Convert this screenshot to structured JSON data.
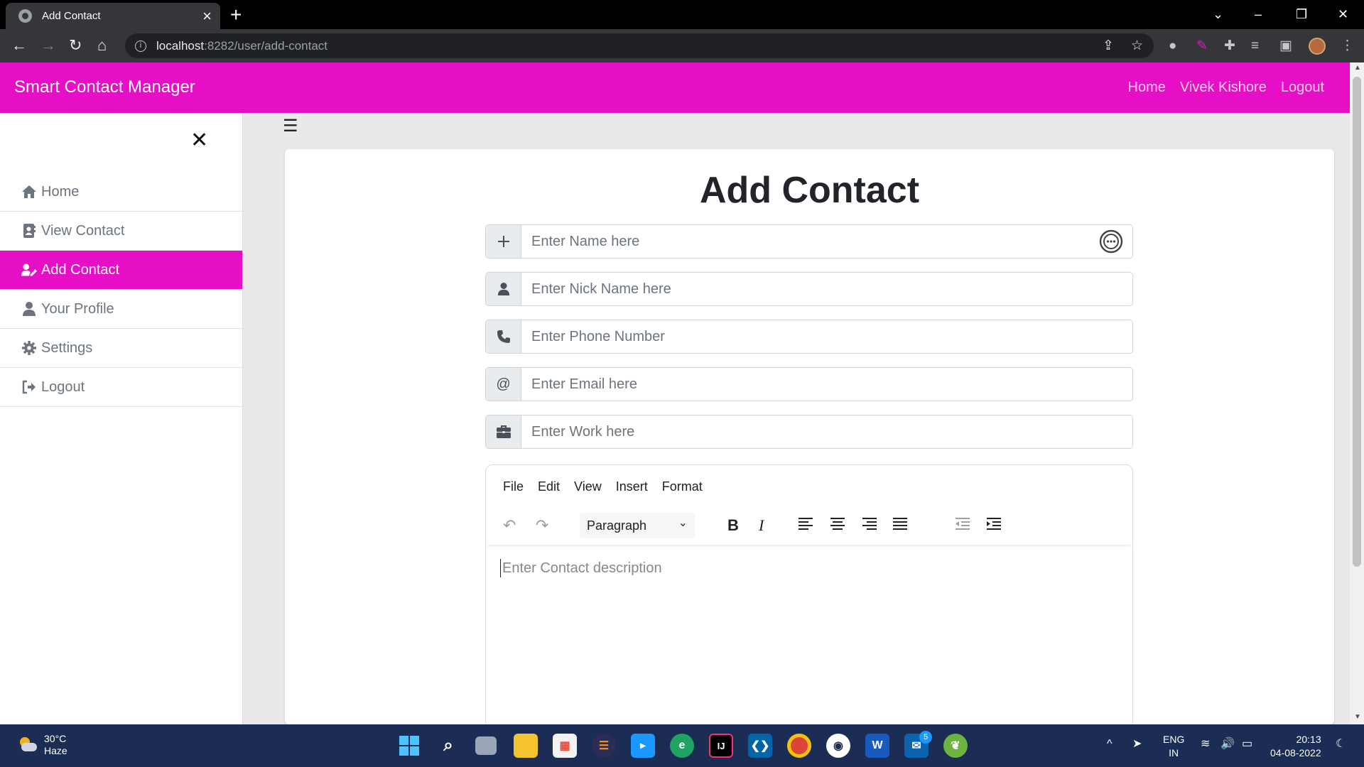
{
  "browser": {
    "tab_title": "Add Contact",
    "url_host": "localhost",
    "url_path": ":8282/user/add-contact"
  },
  "app": {
    "brand": "Smart Contact Manager",
    "nav_links": [
      "Home",
      "Vivek Kishore",
      "Logout"
    ],
    "accent_color": "#e70fc6"
  },
  "sidebar": {
    "items": [
      {
        "label": "Home",
        "icon": "home-icon",
        "active": false
      },
      {
        "label": "View Contact",
        "icon": "address-book-icon",
        "active": false
      },
      {
        "label": "Add Contact",
        "icon": "user-edit-icon",
        "active": true
      },
      {
        "label": "Your Profile",
        "icon": "user-icon",
        "active": false
      },
      {
        "label": "Settings",
        "icon": "gear-icon",
        "active": false
      },
      {
        "label": "Logout",
        "icon": "sign-out-icon",
        "active": false
      }
    ]
  },
  "form": {
    "title": "Add Contact",
    "fields": [
      {
        "placeholder": "Enter Name here",
        "icon": "plus-icon"
      },
      {
        "placeholder": "Enter Nick Name here",
        "icon": "user-icon"
      },
      {
        "placeholder": "Enter Phone Number",
        "icon": "phone-icon"
      },
      {
        "placeholder": "Enter Email here",
        "icon": "at-icon",
        "glyph": "@"
      },
      {
        "placeholder": "Enter Work here",
        "icon": "briefcase-icon"
      }
    ],
    "editor": {
      "menus": [
        "File",
        "Edit",
        "View",
        "Insert",
        "Format"
      ],
      "block_format": "Paragraph",
      "placeholder": "Enter Contact description"
    }
  },
  "taskbar": {
    "temperature": "30°C",
    "weather": "Haze",
    "language": "ENG",
    "region": "IN",
    "time": "20:13",
    "date": "04-08-2022",
    "mail_badge": "5"
  }
}
